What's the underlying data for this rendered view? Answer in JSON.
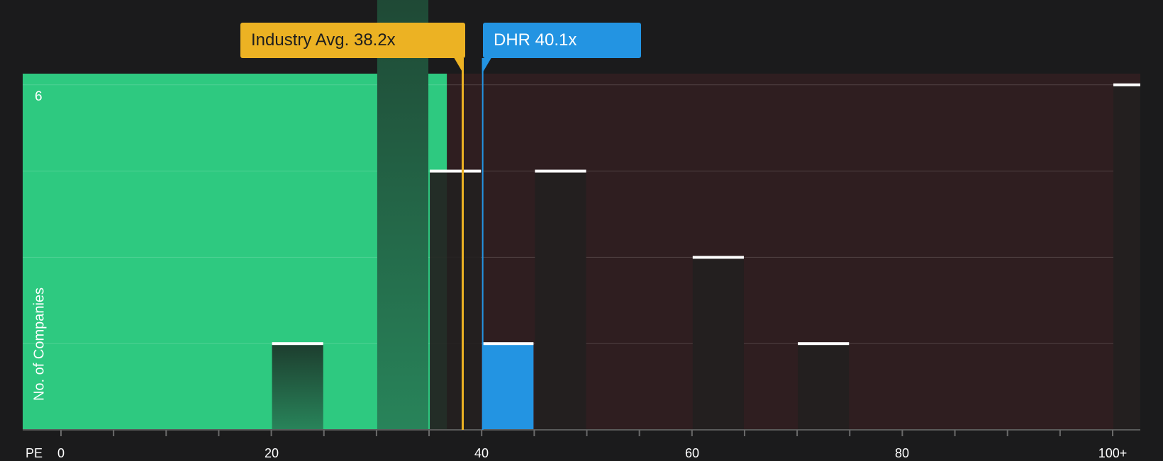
{
  "callouts": {
    "industry": "Industry Avg. 38.2x",
    "company": "DHR 40.1x"
  },
  "colors": {
    "background": "#1b1b1c",
    "undervalued_zone": "#2ec980",
    "overvalued_zone": "#2f1e20",
    "industry_marker": "#ecb223",
    "company_marker": "#2394e2",
    "bar_dark": "#231f1f",
    "bar_company": "#2394e2",
    "bar_cap": "#ffffff"
  },
  "chart_data": {
    "type": "bar",
    "xlabel": "PE",
    "ylabel": "No. of Companies",
    "xlim": [
      0,
      104.5
    ],
    "ylim": [
      0,
      6.14
    ],
    "x_ticks": [
      0,
      20,
      40,
      60,
      80,
      100
    ],
    "x_tick_labels": [
      "0",
      "20",
      "40",
      "60",
      "80",
      "100+"
    ],
    "x_minor_step": 5,
    "y_grid": [
      1,
      2,
      3,
      4,
      5,
      6
    ],
    "y_tick_labels": [
      {
        "value": 6,
        "label": "6"
      }
    ],
    "bins": [
      {
        "x0": 20,
        "x1": 25,
        "count": 1
      },
      {
        "x0": 30,
        "x1": 35,
        "count": 6
      },
      {
        "x0": 35,
        "x1": 40,
        "count": 3
      },
      {
        "x0": 40,
        "x1": 45,
        "count": 1,
        "highlight": true
      },
      {
        "x0": 45,
        "x1": 50,
        "count": 3
      },
      {
        "x0": 60,
        "x1": 65,
        "count": 2
      },
      {
        "x0": 70,
        "x1": 75,
        "count": 1
      },
      {
        "x0": 100,
        "x1": 105,
        "count": 4
      }
    ],
    "undervalued_until": 36.7,
    "industry_avg": 38.2,
    "company_value": 40.1,
    "company": "DHR"
  }
}
